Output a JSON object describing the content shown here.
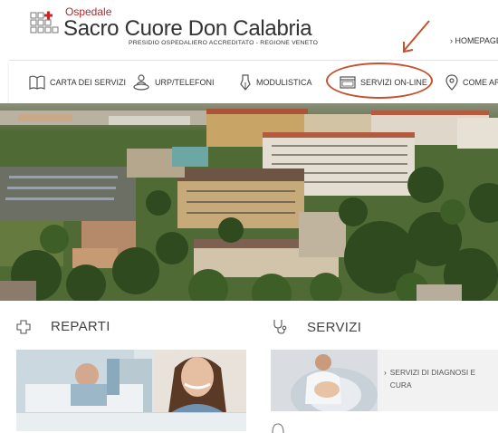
{
  "header": {
    "brand_small": "Ospedale",
    "brand_name": "Sacro Cuore Don Calabria",
    "brand_subtitle": "PRESIDIO OSPEDALIERO ACCREDITATO - REGIONE VENETO",
    "home_link": "› HOMEPAGE"
  },
  "nav": {
    "items": [
      {
        "label": "CARTA DEI SERVIZI",
        "icon": "book-icon"
      },
      {
        "label": "URP/TELEFONI",
        "icon": "person-phone-icon"
      },
      {
        "label": "MODULISTICA",
        "icon": "pen-nib-icon"
      },
      {
        "label": "SERVIZI ON-LINE",
        "icon": "browser-window-icon"
      },
      {
        "label": "COME AR",
        "icon": "location-pin-icon"
      }
    ]
  },
  "sections": {
    "reparti": {
      "title": "REPARTI",
      "icon": "plus-cross-icon"
    },
    "servizi": {
      "title": "SERVIZI",
      "icon": "stethoscope-icon"
    }
  },
  "servizi_card": {
    "link": "SERVIZI DI DIAGNOSI E CURA"
  },
  "colors": {
    "accent_red": "#b0292e",
    "highlight": "#c4522e"
  }
}
